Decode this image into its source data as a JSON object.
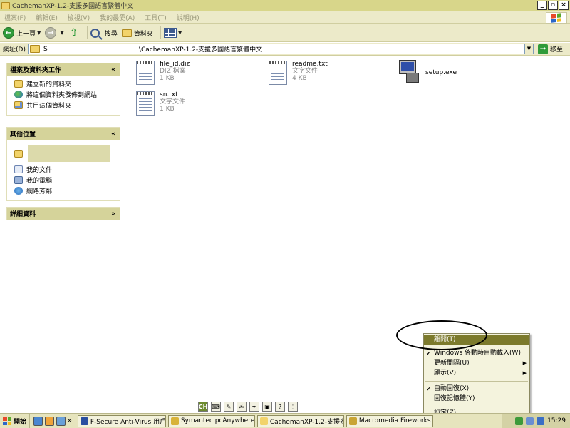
{
  "window": {
    "title": "CachemanXP-1.2-支援多國語言繁體中文",
    "controls": {
      "minimize": "_",
      "maximize": "▫",
      "close": "×"
    }
  },
  "menu": [
    "檔案(F)",
    "編輯(E)",
    "檢視(V)",
    "我的最愛(A)",
    "工具(T)",
    "說明(H)"
  ],
  "toolbar": {
    "back_label": "上一頁",
    "search_label": "搜尋",
    "folders_label": "資料夾"
  },
  "address": {
    "label": "網址(D)",
    "prefix": "S",
    "path": "\\CachemanXP-1.2-支援多國語言繁體中文",
    "go_label": "移至"
  },
  "task_pane": {
    "file_tasks": {
      "title": "檔案及資料夾工作",
      "items": [
        "建立新的資料夾",
        "將這個資料夾發佈到網站",
        "共用這個資料夾"
      ]
    },
    "other_places": {
      "title": "其他位置",
      "items": [
        "我的文件",
        "我的電腦",
        "網路芳鄰"
      ]
    },
    "details": {
      "title": "詳細資料"
    }
  },
  "files": [
    {
      "name": "file_id.diz",
      "type": "DIZ 檔案",
      "size": "1 KB"
    },
    {
      "name": "readme.txt",
      "type": "文字文件",
      "size": "4 KB"
    },
    {
      "name": "setup.exe"
    },
    {
      "name": "sn.txt",
      "type": "文字文件",
      "size": "1 KB"
    }
  ],
  "context_menu": {
    "items": [
      {
        "label": "離開(T)",
        "highlighted": true
      },
      {
        "label": "Windows 啓動時自動載入(W)",
        "checked": true
      },
      {
        "label": "更新間隔(U)",
        "submenu": true
      },
      {
        "label": "顯示(V)",
        "submenu": true
      },
      {
        "label": "自動回復(X)",
        "checked": true
      },
      {
        "label": "回復記憶體(Y)"
      },
      {
        "label": "設定(Z)"
      }
    ]
  },
  "language_bar": {
    "active": "CH"
  },
  "taskbar": {
    "start_label": "開始",
    "quick_more": "»",
    "tasks": [
      "F-Secure Anti-Virus 用戶...",
      "Symantec pcAnywhere",
      "CachemanXP-1.2-支援多...",
      "Macromedia Fireworks M..."
    ],
    "clock": "15:29"
  },
  "colors": {
    "titlebar": "#d8d68a",
    "panel_header": "#d5d39a",
    "menu_highlight": "#7c7a2c"
  }
}
